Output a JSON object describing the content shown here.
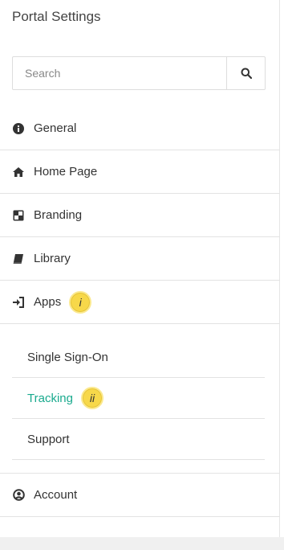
{
  "title": "Portal Settings",
  "search": {
    "placeholder": "Search",
    "icon": "search-icon"
  },
  "menu": [
    {
      "label": "General",
      "icon": "info-circle-icon"
    },
    {
      "label": "Home Page",
      "icon": "home-icon"
    },
    {
      "label": "Branding",
      "icon": "branding-icon"
    },
    {
      "label": "Library",
      "icon": "book-icon"
    },
    {
      "label": "Apps",
      "icon": "sign-in-icon",
      "badge": "i"
    }
  ],
  "submenu": [
    {
      "label": "Single Sign-On"
    },
    {
      "label": "Tracking",
      "active": true,
      "badge": "ii"
    },
    {
      "label": "Support"
    }
  ],
  "account": {
    "label": "Account",
    "icon": "user-circle-icon"
  },
  "colors": {
    "active": "#1aaa8e",
    "badge": "#f7d84a"
  }
}
